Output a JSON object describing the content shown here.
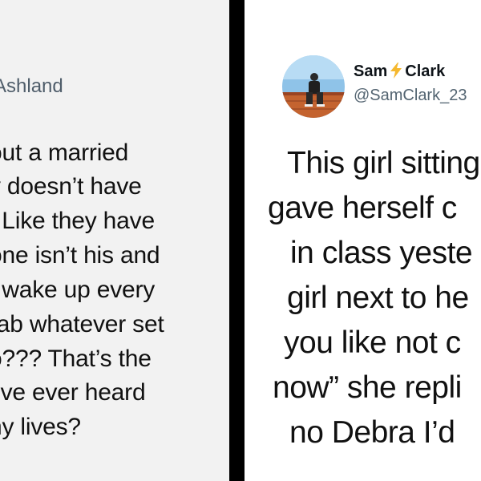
{
  "left_post": {
    "name_fragment": "Ashland",
    "text_lines": [
      "out a married",
      "v doesn’t have",
      ". Like they have",
      "one isn’t his and",
      "t wake up every",
      "rab whatever set",
      "o??? That’s the",
      "I’ve ever heard",
      "ny lives?"
    ]
  },
  "right_post": {
    "author": {
      "first_name": "Sam",
      "last_name": "Clark",
      "emoji_icon": "lightning-bolt-icon",
      "handle": "@SamClark_23"
    },
    "text_lines": [
      "This girl sitting",
      "gave herself c",
      "in class yeste",
      "girl next to he",
      "you like not c",
      "now” she repli",
      "no Debra I’d"
    ]
  },
  "colors": {
    "divider": "#000000",
    "left_background": "#f2f2f2",
    "right_background": "#ffffff",
    "bolt": "#f5b82e",
    "handle": "#536471"
  }
}
